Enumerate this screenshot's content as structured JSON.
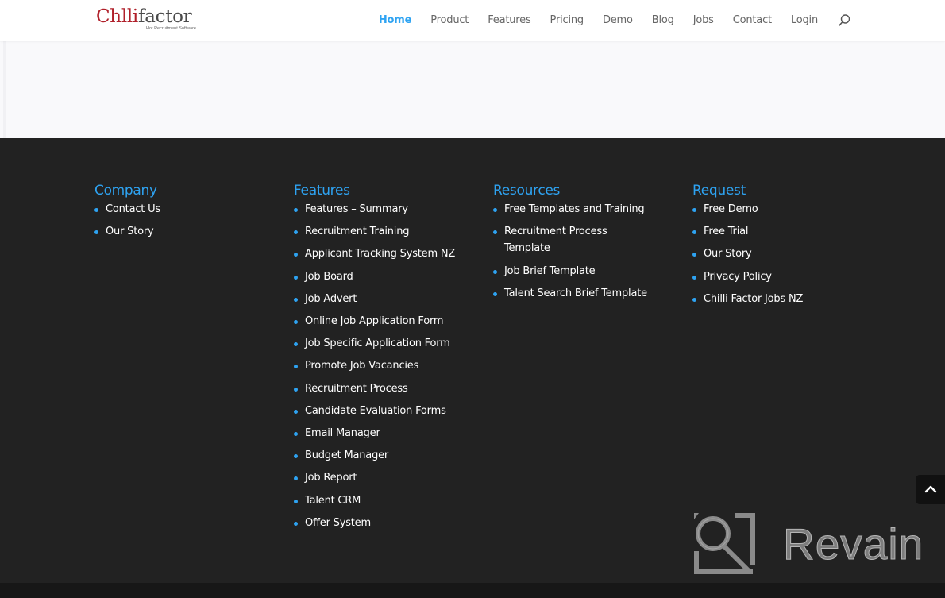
{
  "header": {
    "logo": {
      "text_accent": "Ch",
      "text_accent2": "lli",
      "text_rest": "factor",
      "text_mid": "i",
      "tagline": "Hot Recruitment Software"
    },
    "nav": [
      {
        "label": "Home",
        "active": true
      },
      {
        "label": "Product"
      },
      {
        "label": "Features"
      },
      {
        "label": "Pricing"
      },
      {
        "label": "Demo"
      },
      {
        "label": "Blog"
      },
      {
        "label": "Jobs"
      },
      {
        "label": "Contact"
      },
      {
        "label": "Login"
      }
    ],
    "search_icon": "search-icon"
  },
  "footer": {
    "columns": [
      {
        "title": "Company",
        "items": [
          "Contact Us",
          "Our Story"
        ]
      },
      {
        "title": "Features",
        "items": [
          "Features – Summary",
          "Recruitment Training",
          "Applicant Tracking System NZ",
          "Job Board",
          "Job Advert",
          "Online Job Application Form",
          "Job Specific Application Form",
          "Promote Job Vacancies",
          "Recruitment Process",
          "Candidate Evaluation Forms",
          "Email Manager",
          "Budget Manager",
          "Job Report",
          "Talent CRM",
          "Offer System"
        ]
      },
      {
        "title": "Resources",
        "items": [
          "Free Templates and Training",
          "Recruitment Process Template",
          "Job Brief Template",
          "Talent Search Brief Template"
        ]
      },
      {
        "title": "Request",
        "items": [
          "Free Demo",
          "Free Trial",
          "Our Story",
          "Privacy Policy",
          "Chilli Factor Jobs NZ"
        ]
      }
    ],
    "back_to_top_icon": "chevron-up-icon"
  },
  "watermark": {
    "text": "Revain"
  },
  "colors": {
    "accent": "#2ea3f2",
    "footer_bg": "#222222",
    "bottom_bar": "#171717",
    "logo_red": "#b0202a"
  }
}
